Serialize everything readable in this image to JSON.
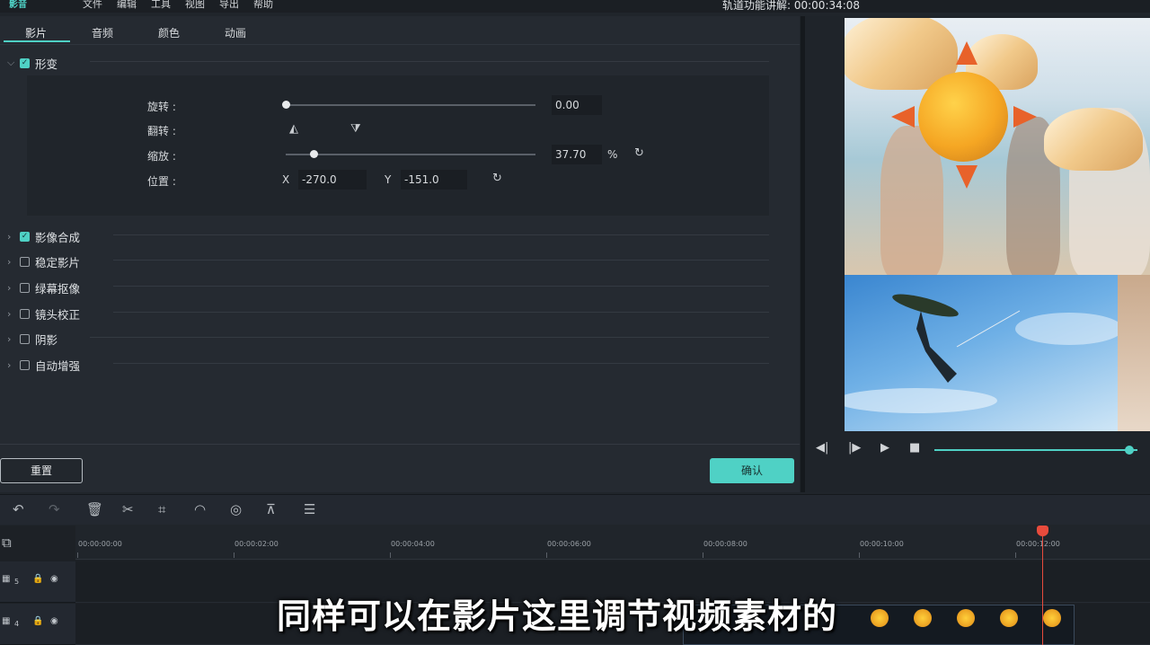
{
  "menubar": {
    "logo": "影音",
    "items": [
      "文件",
      "编辑",
      "工具",
      "视图",
      "导出",
      "帮助"
    ],
    "title": "轨道功能讲解: 00:00:34:08"
  },
  "tabs": [
    "影片",
    "音频",
    "颜色",
    "动画"
  ],
  "transform": {
    "section_label": "形变",
    "rotate_label": "旋转 :",
    "rotate_value": "0.00",
    "rotate_fraction": 0.0,
    "flip_label": "翻转 :",
    "scale_label": "缩放 :",
    "scale_value": "37.70",
    "scale_unit": "%",
    "scale_fraction": 0.11,
    "position_label": "位置 :",
    "x_label": "X",
    "x_value": "-270.0",
    "y_label": "Y",
    "y_value": "-151.0"
  },
  "sections": [
    {
      "label": "影像合成",
      "checked": true
    },
    {
      "label": "稳定影片",
      "checked": false
    },
    {
      "label": "绿幕抠像",
      "checked": false
    },
    {
      "label": "镜头校正",
      "checked": false
    },
    {
      "label": "阴影",
      "checked": false
    },
    {
      "label": "自动增强",
      "checked": false
    }
  ],
  "buttons": {
    "reset": "重置",
    "ok": "确认"
  },
  "preview": {
    "progress_fraction": 0.9
  },
  "timeline": {
    "ticks": [
      "00:00:00:00",
      "00:00:02:00",
      "00:00:04:00",
      "00:00:06:00",
      "00:00:08:00",
      "00:00:10:00",
      "00:00:12:00"
    ],
    "tracks": [
      {
        "number": "5"
      },
      {
        "number": "4"
      }
    ]
  },
  "subtitle": "同样可以在影片这里调节视频素材的",
  "colors": {
    "accent": "#4fd1c5",
    "playhead": "#e84b3c"
  }
}
